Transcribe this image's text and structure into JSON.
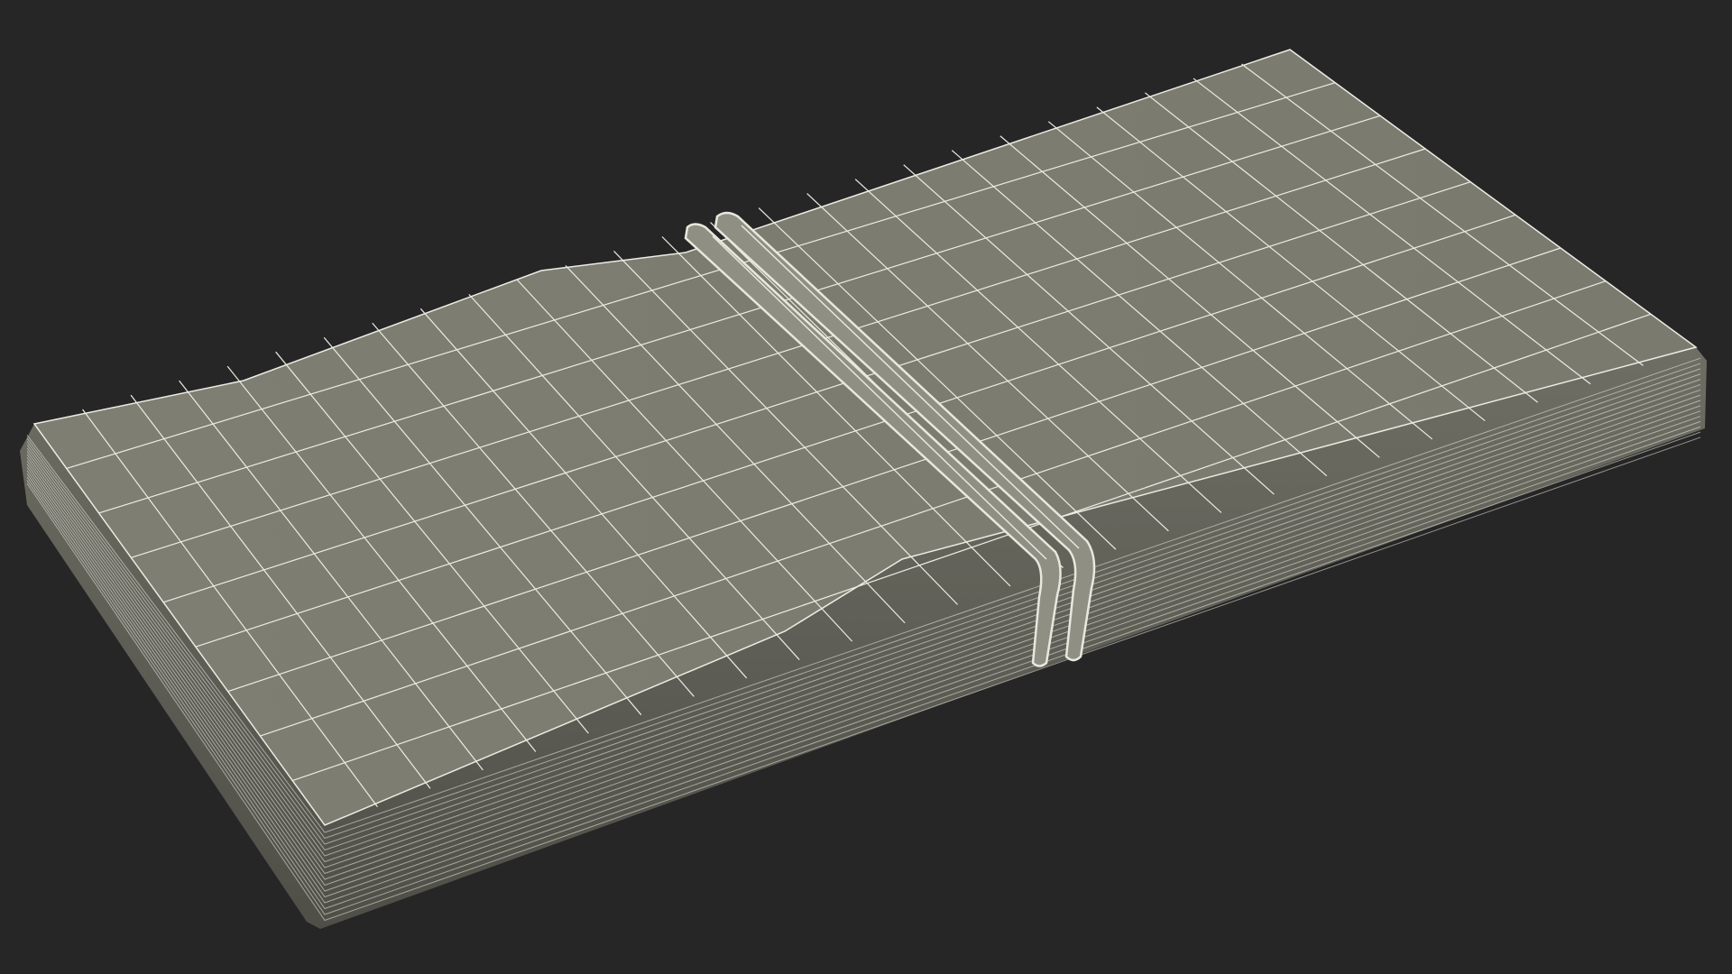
{
  "scene": {
    "subject": "",
    "colors": {
      "background": "#262626",
      "surface": "#7b7b6f",
      "surface_edge": "#8a8a7e",
      "wire": "#ecece4",
      "band": "#8f8f84",
      "band_highlight": "#e8e8de",
      "stack_shadow": "#5f5f56"
    }
  }
}
